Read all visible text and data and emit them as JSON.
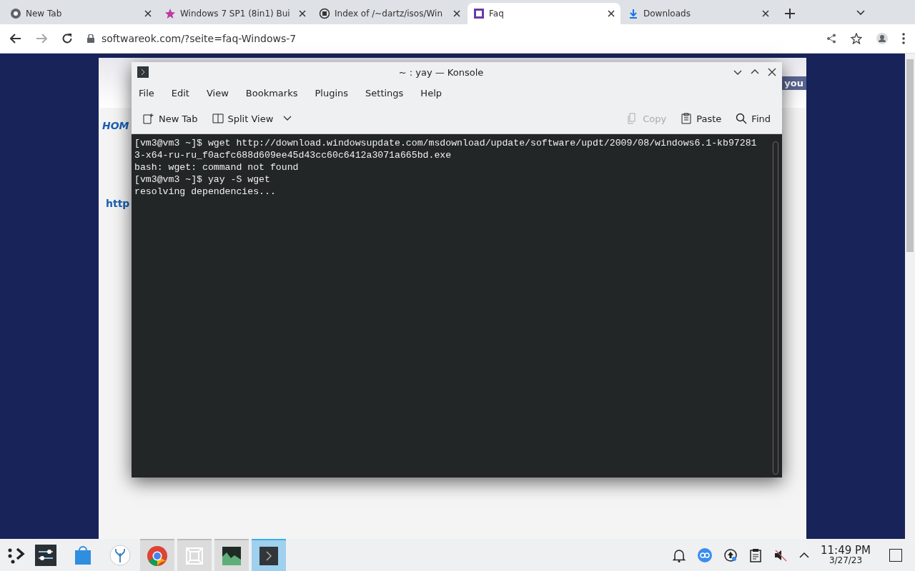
{
  "browser": {
    "tabs": [
      {
        "title": "New Tab",
        "selected": false
      },
      {
        "title": "Windows 7 SP1 (8in1) Bui",
        "selected": false
      },
      {
        "title": "Index of /~dartz/isos/Win",
        "selected": false
      },
      {
        "title": "Faq",
        "selected": true
      },
      {
        "title": "Downloads",
        "selected": false
      }
    ],
    "address": "softwareok.com/?seite=faq-Windows-7"
  },
  "web_page": {
    "nav_link": "HOM",
    "link": "http",
    "header_text": "you"
  },
  "konsole": {
    "title": "~ : yay — Konsole",
    "menu": [
      "File",
      "Edit",
      "View",
      "Bookmarks",
      "Plugins",
      "Settings",
      "Help"
    ],
    "toolbar": [
      {
        "label": "New Tab",
        "kind": "newtab",
        "disabled": false
      },
      {
        "label": "Split View",
        "kind": "split",
        "disabled": false
      },
      {
        "label": "Copy",
        "kind": "copy",
        "disabled": true
      },
      {
        "label": "Paste",
        "kind": "paste",
        "disabled": false
      },
      {
        "label": "Find",
        "kind": "find",
        "disabled": false
      }
    ],
    "lines": [
      "[vm3@vm3 ~]$ wget http://download.windowsupdate.com/msdownload/update/software/updt/2009/08/windows6.1-kb97281",
      "3-x64-ru-ru_f0acfc688d609ee45d43cc60c6412a3071a665bd.exe",
      "bash: wget: command not found",
      "[vm3@vm3 ~]$ yay -S wget",
      "resolving dependencies..."
    ]
  },
  "taskbar": {
    "apps": [
      {
        "kind": "settings",
        "selected": false
      },
      {
        "kind": "store",
        "selected": false
      },
      {
        "kind": "coral",
        "selected": false
      },
      {
        "kind": "chrome",
        "selected": false
      },
      {
        "kind": "frame",
        "selected": false
      },
      {
        "kind": "monitor",
        "selected": false
      },
      {
        "kind": "terminal",
        "selected": true
      }
    ],
    "time": "11:49 PM",
    "date": "3/27/23"
  }
}
